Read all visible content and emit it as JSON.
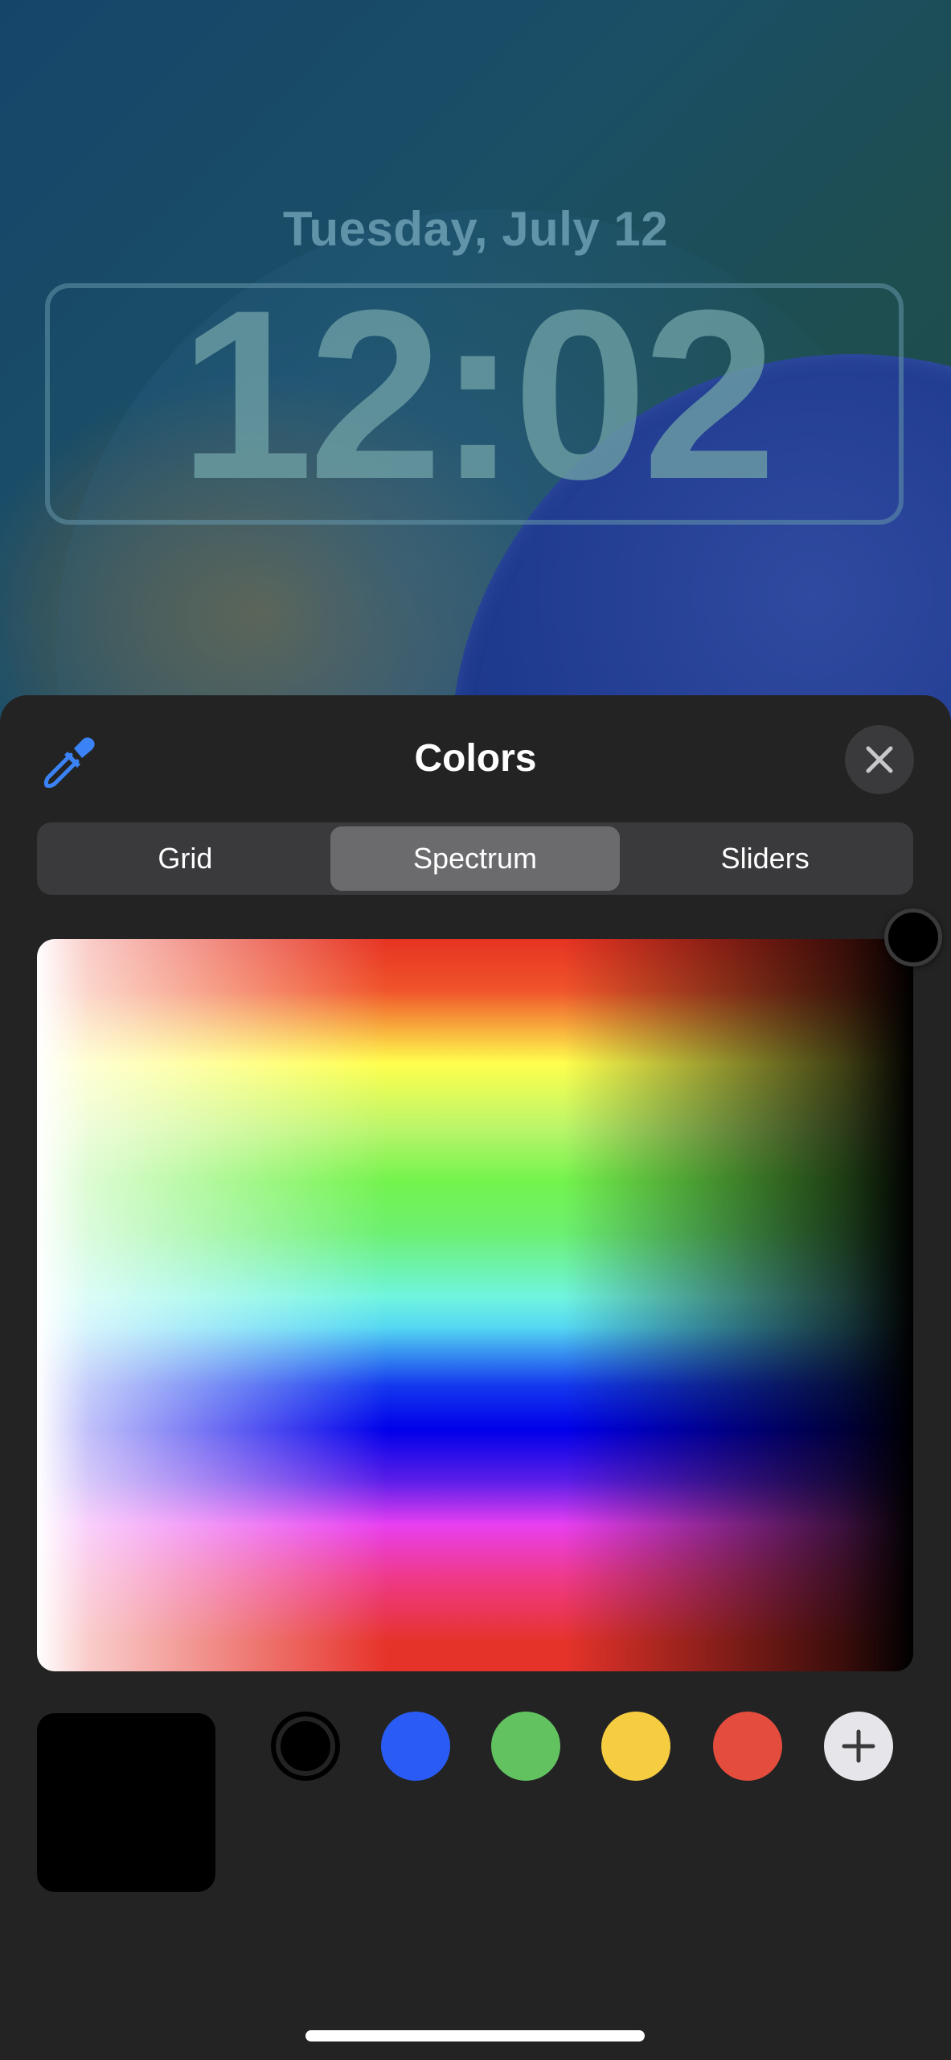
{
  "lockscreen": {
    "date": "Tuesday, July 12",
    "time": "12:02"
  },
  "sheet": {
    "title": "Colors",
    "tabs": [
      {
        "label": "Grid",
        "active": false
      },
      {
        "label": "Spectrum",
        "active": true
      },
      {
        "label": "Sliders",
        "active": false
      }
    ],
    "selected_color": "#000000",
    "swatches": [
      {
        "name": "black",
        "color": "#000000",
        "selected": true
      },
      {
        "name": "blue",
        "color": "#2a5cf5"
      },
      {
        "name": "green",
        "color": "#62c260"
      },
      {
        "name": "yellow",
        "color": "#f6cd41"
      },
      {
        "name": "red",
        "color": "#e44c3d"
      }
    ],
    "icons": {
      "eyedropper": "eyedropper-icon",
      "close": "close-icon",
      "add": "plus-icon"
    },
    "accent_color": "#3b82f6"
  }
}
